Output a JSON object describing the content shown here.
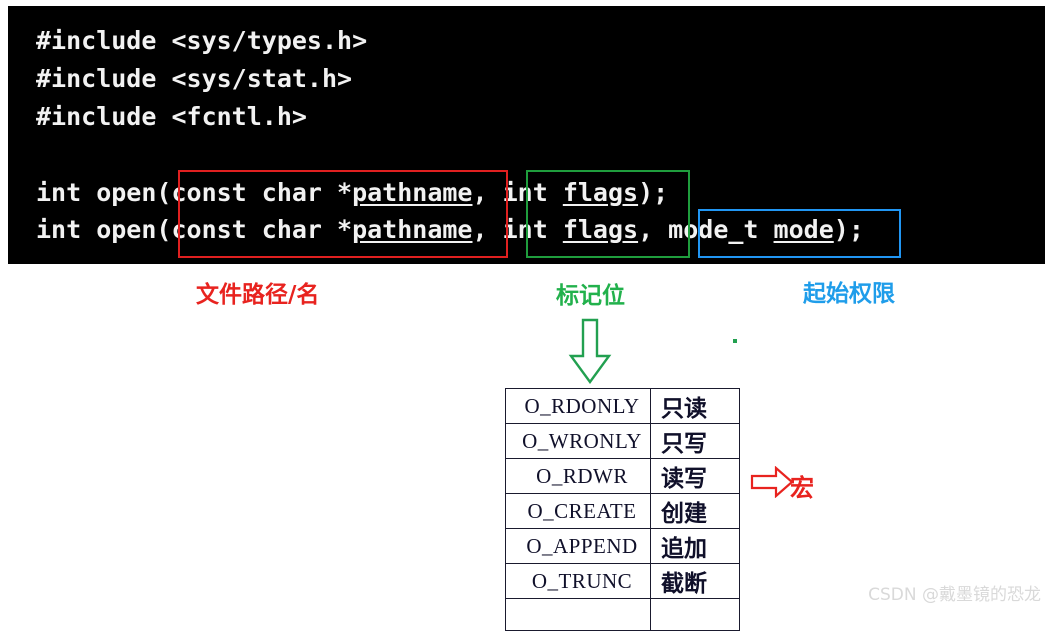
{
  "code_block": {
    "background": "#000000",
    "foreground": "#f2f2f2",
    "includes": [
      "#include <sys/types.h>",
      "#include <sys/stat.h>",
      "#include <fcntl.h>"
    ],
    "signature_1": {
      "prefix": "int open(const char *",
      "param_1": "pathname",
      "middle": ", int ",
      "param_2": "flags",
      "suffix": ");"
    },
    "signature_2": {
      "prefix": "int open(const char *",
      "param_1": "pathname",
      "middle": ", int ",
      "param_2": "flags",
      "middle_2": ", mode_t ",
      "param_3": "mode",
      "suffix": ");"
    }
  },
  "highlights": {
    "pathname_box_color": "#e02020",
    "flags_box_color": "#1f9d3d",
    "mode_box_color": "#2196f3"
  },
  "annotations": {
    "pathname_label": "文件路径/名",
    "pathname_label_color": "#e8231f",
    "flags_label": "标记位",
    "flags_label_color": "#22b14c",
    "mode_label": "起始权限",
    "mode_label_color": "#1f9dea",
    "macro_label": "宏",
    "macro_label_color": "#e8231f"
  },
  "flags_table": {
    "rows": [
      {
        "macro": "O_RDONLY",
        "desc": "只读"
      },
      {
        "macro": "O_WRONLY",
        "desc": "只写"
      },
      {
        "macro": "O_RDWR",
        "desc": "读写"
      },
      {
        "macro": "O_CREATE",
        "desc": "创建"
      },
      {
        "macro": "O_APPEND",
        "desc": "追加"
      },
      {
        "macro": "O_TRUNC",
        "desc": "截断"
      },
      {
        "macro": "",
        "desc": ""
      }
    ]
  },
  "watermark": {
    "text": "CSDN @戴墨镜的恐龙"
  }
}
